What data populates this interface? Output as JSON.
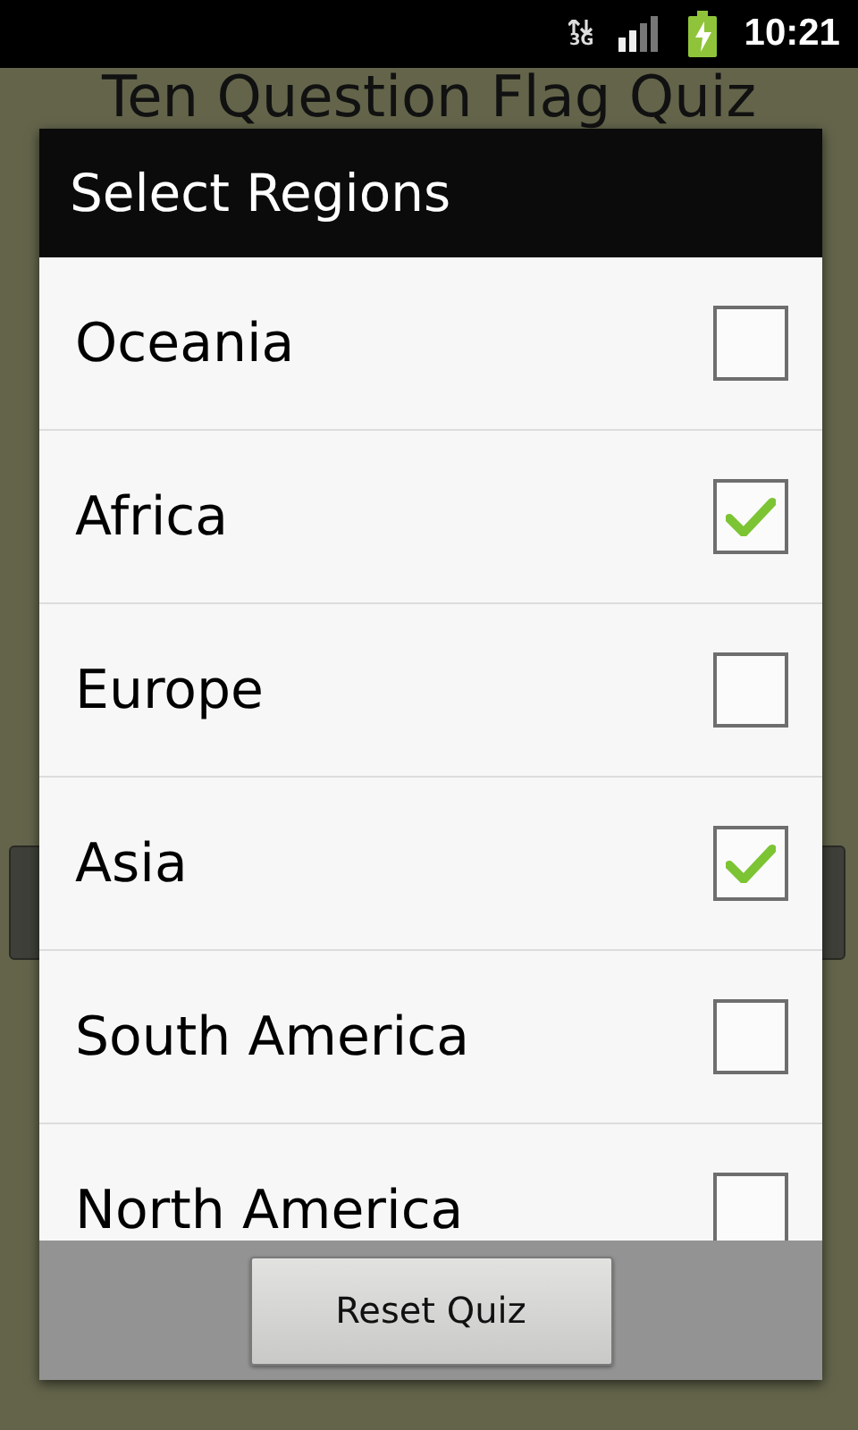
{
  "status_bar": {
    "network_type": "3G",
    "time": "10:21"
  },
  "background": {
    "title": "Ten Question Flag Quiz"
  },
  "dialog": {
    "title": "Select Regions",
    "items": [
      {
        "label": "Oceania",
        "checked": false
      },
      {
        "label": "Africa",
        "checked": true
      },
      {
        "label": "Europe",
        "checked": false
      },
      {
        "label": "Asia",
        "checked": true
      },
      {
        "label": "South America",
        "checked": false
      },
      {
        "label": "North America",
        "checked": false
      }
    ],
    "button": "Reset Quiz"
  }
}
